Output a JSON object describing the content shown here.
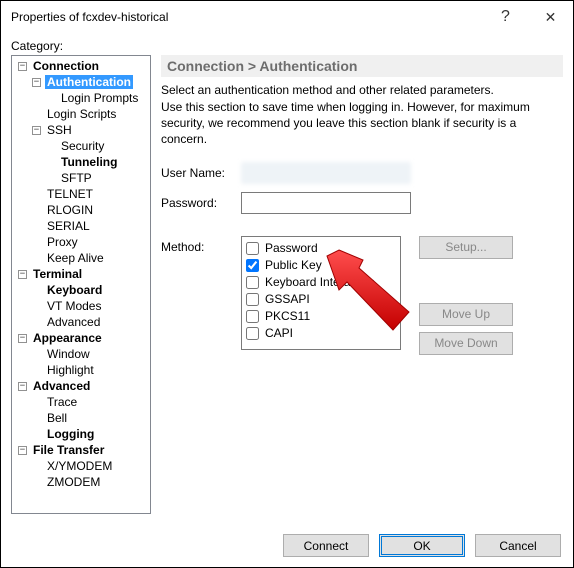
{
  "window": {
    "title": "Properties of fcxdev-historical",
    "help_icon": "?",
    "close_icon": "✕"
  },
  "category_label": "Category:",
  "tree": {
    "connection": "Connection",
    "authentication": "Authentication",
    "login_prompts": "Login Prompts",
    "login_scripts": "Login Scripts",
    "ssh": "SSH",
    "security": "Security",
    "tunneling": "Tunneling",
    "sftp": "SFTP",
    "telnet": "TELNET",
    "rlogin": "RLOGIN",
    "serial": "SERIAL",
    "proxy": "Proxy",
    "keep_alive": "Keep Alive",
    "terminal": "Terminal",
    "keyboard": "Keyboard",
    "vt_modes": "VT Modes",
    "advanced_t": "Advanced",
    "appearance": "Appearance",
    "window": "Window",
    "highlight": "Highlight",
    "advanced": "Advanced",
    "trace": "Trace",
    "bell": "Bell",
    "logging": "Logging",
    "file_transfer": "File Transfer",
    "xymodem": "X/YMODEM",
    "zmodem": "ZMODEM"
  },
  "panel": {
    "breadcrumb": "Connection > Authentication",
    "desc1": "Select an authentication method and other related parameters.",
    "desc2": "Use this section to save time when logging in. However, for maximum security, we recommend you leave this section blank if security is a concern.",
    "username_label": "User Name:",
    "password_label": "Password:",
    "method_label": "Method:",
    "methods": {
      "password": "Password",
      "public_key": "Public Key",
      "keyboard": "Keyboard Interactive",
      "gssapi": "GSSAPI",
      "pkcs11": "PKCS11",
      "capi": "CAPI"
    },
    "setup_btn": "Setup...",
    "moveup_btn": "Move Up",
    "movedown_btn": "Move Down"
  },
  "buttons": {
    "connect": "Connect",
    "ok": "OK",
    "cancel": "Cancel"
  }
}
